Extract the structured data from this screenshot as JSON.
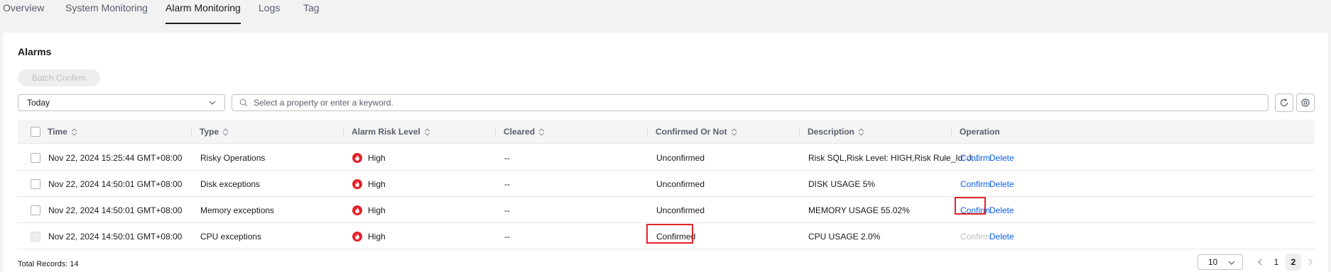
{
  "tabs": [
    {
      "label": "Overview",
      "active": false
    },
    {
      "label": "System Monitoring",
      "active": false
    },
    {
      "label": "Alarm Monitoring",
      "active": true
    },
    {
      "label": "Logs",
      "active": false
    },
    {
      "label": "Tag",
      "active": false
    }
  ],
  "card": {
    "title": "Alarms",
    "batch_confirm_label": "Batch Confirm",
    "time_filter": {
      "value": "Today"
    },
    "search": {
      "placeholder": "Select a property or enter a keyword."
    },
    "icons": {
      "refresh": "refresh-icon",
      "settings": "settings-icon"
    }
  },
  "table": {
    "columns": [
      "Time",
      "Type",
      "Alarm Risk Level",
      "Cleared",
      "Confirmed Or Not",
      "Description",
      "Operation"
    ],
    "rows": [
      {
        "time": "Nov 22, 2024 15:25:44 GMT+08:00",
        "type": "Risky Operations",
        "risk": "High",
        "cleared": "--",
        "confirmed": "Unconfirmed",
        "description": "Risk SQL,Risk Level: HIGH,Risk Rule_Id: J...",
        "confirm": "Confirm",
        "delete": "Delete",
        "confirm_enabled": true,
        "checkbox_enabled": true
      },
      {
        "time": "Nov 22, 2024 14:50:01 GMT+08:00",
        "type": "Disk exceptions",
        "risk": "High",
        "cleared": "--",
        "confirmed": "Unconfirmed",
        "description": "DISK USAGE 5%",
        "confirm": "Confirm",
        "delete": "Delete",
        "confirm_enabled": true,
        "checkbox_enabled": true
      },
      {
        "time": "Nov 22, 2024 14:50:01 GMT+08:00",
        "type": "Memory exceptions",
        "risk": "High",
        "cleared": "--",
        "confirmed": "Unconfirmed",
        "description": "MEMORY USAGE 55.02%",
        "confirm": "Confirm",
        "delete": "Delete",
        "confirm_enabled": true,
        "checkbox_enabled": true
      },
      {
        "time": "Nov 22, 2024 14:50:01 GMT+08:00",
        "type": "CPU exceptions",
        "risk": "High",
        "cleared": "--",
        "confirmed": "Confirmed",
        "description": "CPU USAGE 2.0%",
        "confirm": "Confirm",
        "delete": "Delete",
        "confirm_enabled": false,
        "checkbox_enabled": false
      }
    ]
  },
  "footer": {
    "total_records": "Total Records: 14",
    "page_size": "10",
    "pages": [
      "1",
      "2"
    ],
    "current_page": "2"
  },
  "colors": {
    "link": "#0d60e7",
    "risk_high": "#e5222a",
    "highlight": "#e5222a",
    "disabled": "#bfbfbf"
  }
}
